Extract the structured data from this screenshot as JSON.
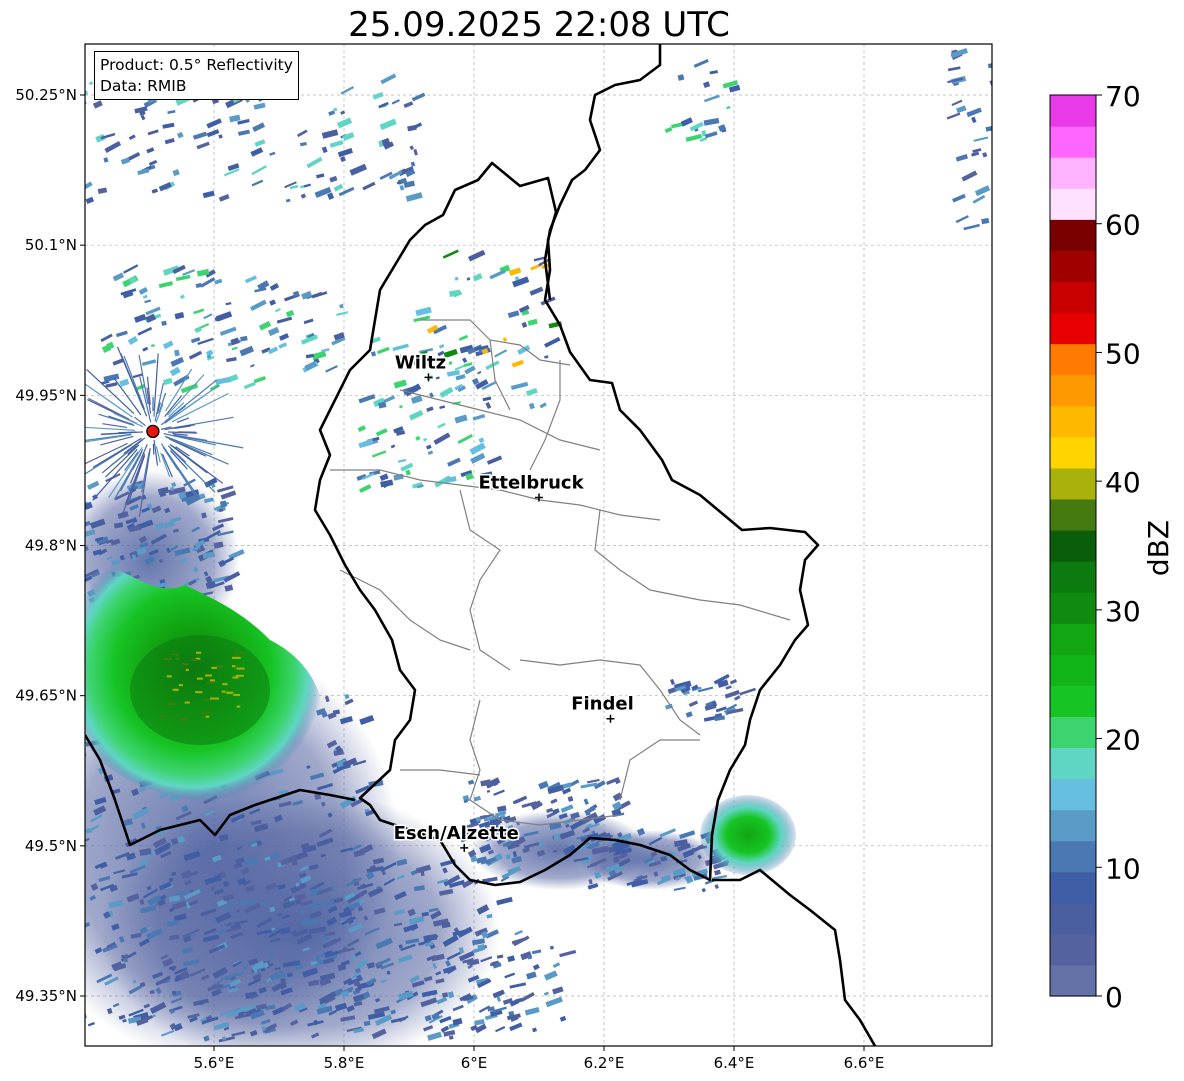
{
  "title": "25.09.2025 22:08 UTC",
  "info": {
    "product": "Product: 0.5° Reflectivity",
    "data": "Data: RMIB"
  },
  "axes": {
    "lon_ticks": [
      "5.6°E",
      "5.8°E",
      "6°E",
      "6.2°E",
      "6.4°E",
      "6.6°E"
    ],
    "lat_ticks": [
      "50.25°N",
      "50.1°N",
      "49.95°N",
      "49.8°N",
      "49.65°N",
      "49.5°N",
      "49.35°N"
    ]
  },
  "cities": [
    {
      "name": "Wiltz",
      "lon": 5.93,
      "lat": 49.968
    },
    {
      "name": "Ettelbruck",
      "lon": 6.1,
      "lat": 49.848
    },
    {
      "name": "Findel",
      "lon": 6.21,
      "lat": 49.627
    },
    {
      "name": "Esch/Alzette",
      "lon": 5.985,
      "lat": 49.498
    }
  ],
  "radar_site": {
    "lon": 5.506,
    "lat": 49.914,
    "color": "#e8140f"
  },
  "colorbar": {
    "label": "dBZ",
    "ticks": [
      "0",
      "10",
      "20",
      "30",
      "40",
      "50",
      "60",
      "70"
    ],
    "colors": [
      "#6472a8",
      "#5463a0",
      "#4a5fa0",
      "#3f5ea6",
      "#4a78b2",
      "#5a9ac6",
      "#66bfe0",
      "#5fd6c4",
      "#3dd470",
      "#16c424",
      "#12b518",
      "#12a612",
      "#108a10",
      "#0d7a10",
      "#0a5e0a",
      "#457a10",
      "#a8b20a",
      "#ffd500",
      "#ffb800",
      "#ff9900",
      "#ff7a00",
      "#e80000",
      "#c80000",
      "#a00000",
      "#780000",
      "#ffe0ff",
      "#ffb3ff",
      "#ff66ff",
      "#e83ae8"
    ]
  },
  "colors": {
    "border": "#000000",
    "communes": "#808080",
    "grid": "#b0b0b0"
  },
  "chart_data": {
    "type": "heatmap",
    "title": "25.09.2025 22:08 UTC",
    "xlabel": "",
    "ylabel": "",
    "xlim": [
      5.4,
      6.8
    ],
    "ylim": [
      49.3,
      50.3
    ],
    "x_ticks": [
      5.6,
      5.8,
      6.0,
      6.2,
      6.4,
      6.6
    ],
    "y_ticks": [
      49.35,
      49.5,
      49.65,
      49.8,
      49.95,
      50.1,
      50.25
    ],
    "colorbar_range": [
      0,
      70
    ],
    "colorbar_label": "dBZ",
    "echoes": [
      {
        "region": "southwest main cell",
        "center_lon": 5.62,
        "center_lat": 49.66,
        "peak_dbz": 40
      },
      {
        "region": "southeast cell",
        "center_lon": 6.43,
        "center_lat": 49.5,
        "peak_dbz": 25
      },
      {
        "region": "north scattered",
        "center_lon": 6.05,
        "center_lat": 50.0,
        "peak_dbz": 45
      }
    ]
  }
}
